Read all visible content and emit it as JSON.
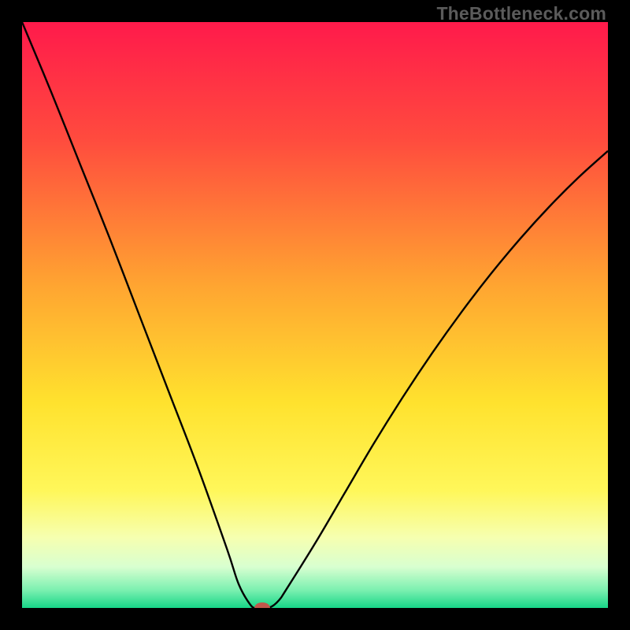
{
  "watermark": "TheBottleneck.com",
  "chart_data": {
    "type": "line",
    "title": "",
    "xlabel": "",
    "ylabel": "",
    "xlim": [
      0,
      100
    ],
    "ylim": [
      0,
      100
    ],
    "x": [
      0,
      5,
      10,
      15,
      20,
      25,
      30,
      35,
      37,
      39,
      40,
      41,
      42,
      43,
      44,
      45,
      50,
      55,
      60,
      65,
      70,
      75,
      80,
      85,
      90,
      95,
      100
    ],
    "values": [
      100,
      88.0,
      75.5,
      63.0,
      50.0,
      37.0,
      24.0,
      10.0,
      4.0,
      0.5,
      0.0,
      0.0,
      0.0,
      0.5,
      1.5,
      3.0,
      11.0,
      19.5,
      28.0,
      36.0,
      43.5,
      50.5,
      57.0,
      63.0,
      68.5,
      73.5,
      78.0
    ],
    "marker": {
      "x": 41.0,
      "y": 0.0,
      "color": "#c1584c"
    },
    "gradient_stops": [
      {
        "offset": 0,
        "color": "#ff1a4b"
      },
      {
        "offset": 20,
        "color": "#ff4b3e"
      },
      {
        "offset": 45,
        "color": "#ffa531"
      },
      {
        "offset": 65,
        "color": "#ffe22e"
      },
      {
        "offset": 80,
        "color": "#fff75a"
      },
      {
        "offset": 88,
        "color": "#f6ffb0"
      },
      {
        "offset": 93,
        "color": "#d8ffd0"
      },
      {
        "offset": 97,
        "color": "#7af0b0"
      },
      {
        "offset": 100,
        "color": "#17d587"
      }
    ]
  }
}
